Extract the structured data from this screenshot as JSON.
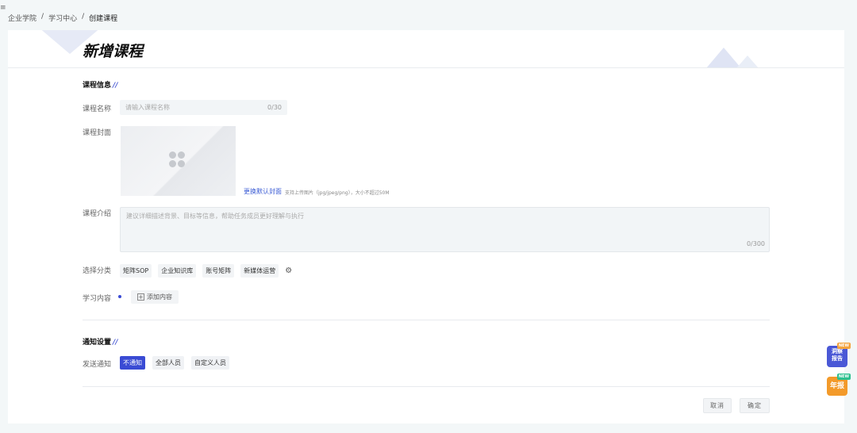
{
  "menu_icon": "≡",
  "breadcrumb": [
    "企业学院",
    "学习中心",
    "创建课程"
  ],
  "breadcrumb_sep": "/",
  "page_title": "新增课程",
  "sections": {
    "course_info": "课程信息",
    "notify": "通知设置",
    "slash": "//"
  },
  "fields": {
    "name_label": "课程名称",
    "name_placeholder": "请输入课程名称",
    "name_count": "0/30",
    "cover_label": "课程封面",
    "cover_link": "更换默认封面",
    "cover_hint": "支持上传图片（jpg/jpeg/png），大小不超过50M",
    "intro_label": "课程介绍",
    "intro_placeholder": "建议详细描述背景、目标等信息，帮助任务成员更好理解与执行",
    "intro_count": "0/300",
    "category_label": "选择分类",
    "categories": [
      "矩阵SOP",
      "企业知识库",
      "账号矩阵",
      "新媒体运营"
    ],
    "content_label": "学习内容",
    "add_content": "添加内容",
    "notify_label": "发送通知",
    "notify_options": [
      "不通知",
      "全部人员",
      "自定义人员"
    ],
    "notify_selected": 0
  },
  "footer": {
    "cancel": "取消",
    "confirm": "确定"
  },
  "floating": {
    "badge1_text": [
      "洞察",
      "报告"
    ],
    "badge1_tag": "NEW",
    "badge2_text": "年报",
    "badge2_tag": "NEW"
  },
  "colors": {
    "accent": "#3a4bd4",
    "link": "#3a5bd4",
    "badge_orange": "#f39a2a",
    "badge_blue": "#4a58d6"
  }
}
